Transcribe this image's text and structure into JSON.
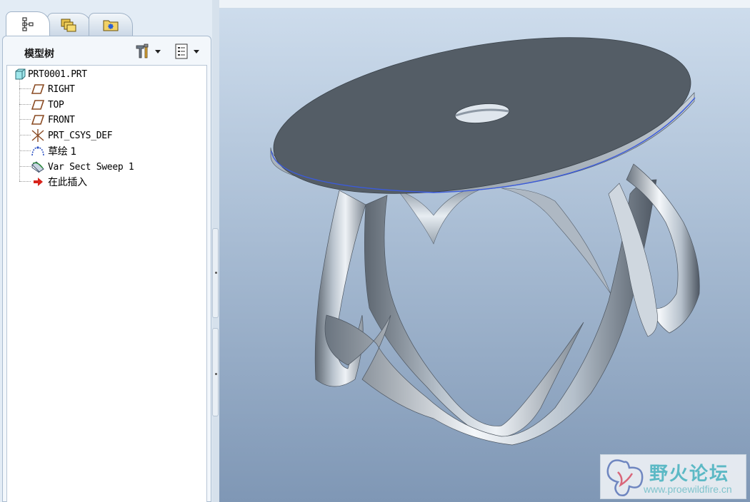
{
  "panel": {
    "title": "模型树",
    "tabs": [
      {
        "icon": "model-tree-icon",
        "active": true
      },
      {
        "icon": "folder-browser-icon",
        "active": false
      },
      {
        "icon": "favorites-folder-icon",
        "active": false
      }
    ],
    "header_buttons": [
      "settings-tools-icon",
      "show-options-icon"
    ]
  },
  "tree": {
    "root": {
      "label": "PRT0001.PRT",
      "icon": "part-icon"
    },
    "items": [
      {
        "label": "RIGHT",
        "icon": "datum-plane-icon"
      },
      {
        "label": "TOP",
        "icon": "datum-plane-icon"
      },
      {
        "label": "FRONT",
        "icon": "datum-plane-icon"
      },
      {
        "label": "PRT_CSYS_DEF",
        "icon": "coordinate-system-icon"
      },
      {
        "label": "草绘 1",
        "icon": "sketch-icon"
      },
      {
        "label": "Var Sect Sweep 1",
        "icon": "variable-section-sweep-icon"
      },
      {
        "label": "在此插入",
        "icon": "insert-here-arrow-icon"
      }
    ]
  },
  "watermark": {
    "title": "野火论坛",
    "url": "www.proewildfire.cn"
  },
  "colors": {
    "viewport_top": "#cddcec",
    "viewport_bottom": "#7f97b5",
    "model_top": "#545d66",
    "edge_highlight": "#3b5bdc",
    "watermark_text": "#5cb9c5"
  }
}
